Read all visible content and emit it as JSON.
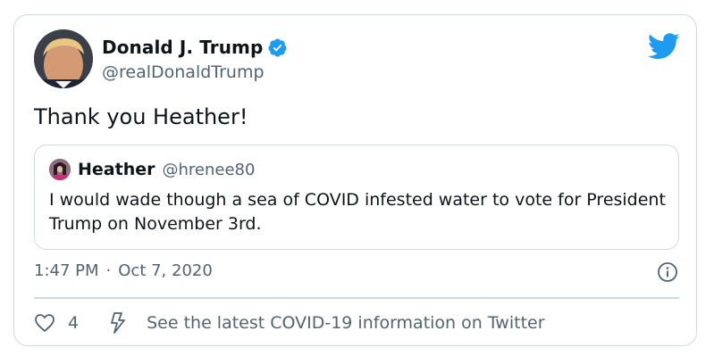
{
  "author": {
    "display_name": "Donald J. Trump",
    "handle": "@realDonaldTrump",
    "verified": true
  },
  "tweet": {
    "text": "Thank you Heather!"
  },
  "quoted_tweet": {
    "display_name": "Heather",
    "handle": "@hrenee80",
    "text": "I would wade though a sea of COVID infested water to vote for President Trump on November 3rd."
  },
  "meta": {
    "time": "1:47 PM",
    "separator": "·",
    "date": "Oct 7, 2020"
  },
  "actions": {
    "like_count": "4",
    "covid_link_text": "See the latest COVID-19 information on Twitter"
  },
  "colors": {
    "text_primary": "#0f1419",
    "text_secondary": "#536471",
    "border": "#cfd9de",
    "twitter_blue": "#1d9bf0"
  },
  "icons": {
    "logo": "twitter-bird-icon",
    "verified": "verified-badge-icon",
    "info": "info-icon",
    "like": "heart-icon",
    "covid": "lightning-bolt-icon"
  }
}
